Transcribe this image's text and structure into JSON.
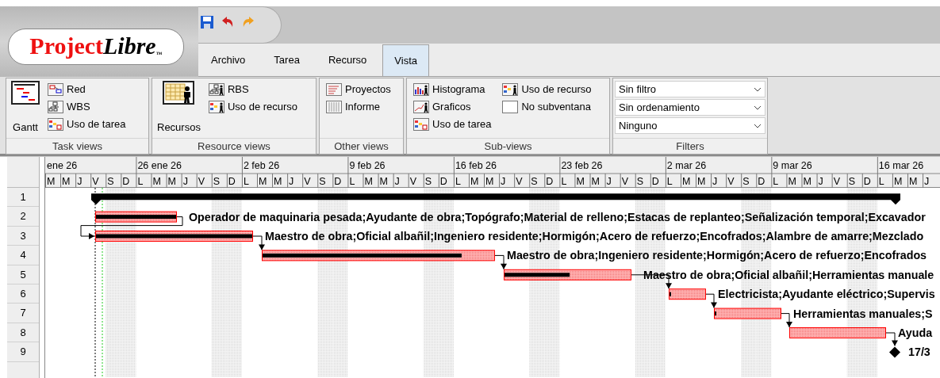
{
  "logo": {
    "name": "Project",
    "suffix": "Libre",
    "mark": "™"
  },
  "tabs": [
    {
      "label": "Archivo",
      "selected": false
    },
    {
      "label": "Tarea",
      "selected": false
    },
    {
      "label": "Recurso",
      "selected": false
    },
    {
      "label": "Vista",
      "selected": true
    }
  ],
  "ribbon": {
    "groups": [
      {
        "title": "Task views",
        "large": {
          "label": "Gantt"
        },
        "items": [
          "Red",
          "WBS",
          "Uso de tarea"
        ]
      },
      {
        "title": "Resource views",
        "large": {
          "label": "Recursos"
        },
        "items": [
          "RBS",
          "Uso de recurso"
        ]
      },
      {
        "title": "Other views",
        "items": [
          "Proyectos",
          "Informe"
        ]
      },
      {
        "title": "Sub-views",
        "items": [
          "Histograma",
          "Graficos",
          "Uso de tarea",
          "Uso de recurso",
          "No subventana"
        ]
      },
      {
        "title": "Filters",
        "dropdowns": [
          "Sin filtro",
          "Sin ordenamiento",
          "Ninguno"
        ]
      }
    ]
  },
  "timescale": {
    "weeks": [
      "ene 26",
      "26 ene 26",
      "2 feb 26",
      "9 feb 26",
      "16 feb 26",
      "23 feb 26",
      "2 mar 26",
      "9 mar 26",
      "16 mar 26"
    ],
    "days": [
      "M",
      "M",
      "J",
      "V",
      "S",
      "D",
      "L",
      "M",
      "M",
      "J",
      "V",
      "S",
      "D",
      "L",
      "M",
      "M",
      "J",
      "V",
      "S",
      "D",
      "L",
      "M",
      "M",
      "J",
      "V",
      "S",
      "D",
      "L",
      "M",
      "M",
      "J",
      "V",
      "S",
      "D",
      "L",
      "M",
      "M",
      "J",
      "V",
      "S",
      "D",
      "L",
      "M",
      "M",
      "J",
      "V",
      "S",
      "D",
      "L",
      "M",
      "M",
      "J",
      "V",
      "S",
      "D",
      "L",
      "M",
      "M",
      "J"
    ]
  },
  "rows": [
    "1",
    "2",
    "3",
    "4",
    "5",
    "6",
    "7",
    "8",
    "9"
  ],
  "tasks": [
    {
      "kind": "summary"
    },
    {
      "kind": "task",
      "level": 1,
      "resources": "Operador de maquinaria pesada;Ayudante de obra;Topógrafo;Material de relleno;Estacas de replanteo;Señalización temporal;Excavador"
    },
    {
      "kind": "task",
      "level": 1,
      "resources": "Maestro de obra;Oficial albañil;Ingeniero residente;Hormigón;Acero de refuerzo;Encofrados;Alambre de amarre;Mezclado"
    },
    {
      "kind": "task",
      "level": 0.86,
      "resources": "Maestro de obra;Ingeniero residente;Hormigón;Acero de refuerzo;Encofrados"
    },
    {
      "kind": "task",
      "level": 0.52,
      "resources": "Maestro de obra;Oficial albañil;Herramientas manuale"
    },
    {
      "kind": "task",
      "level": 0.06,
      "resources": "Electricista;Ayudante eléctrico;Supervis"
    },
    {
      "kind": "task",
      "level": 0.03,
      "resources": "Herramientas manuales;S"
    },
    {
      "kind": "task",
      "resources": "Ayuda"
    },
    {
      "kind": "milestone",
      "label": "17/3"
    }
  ]
}
